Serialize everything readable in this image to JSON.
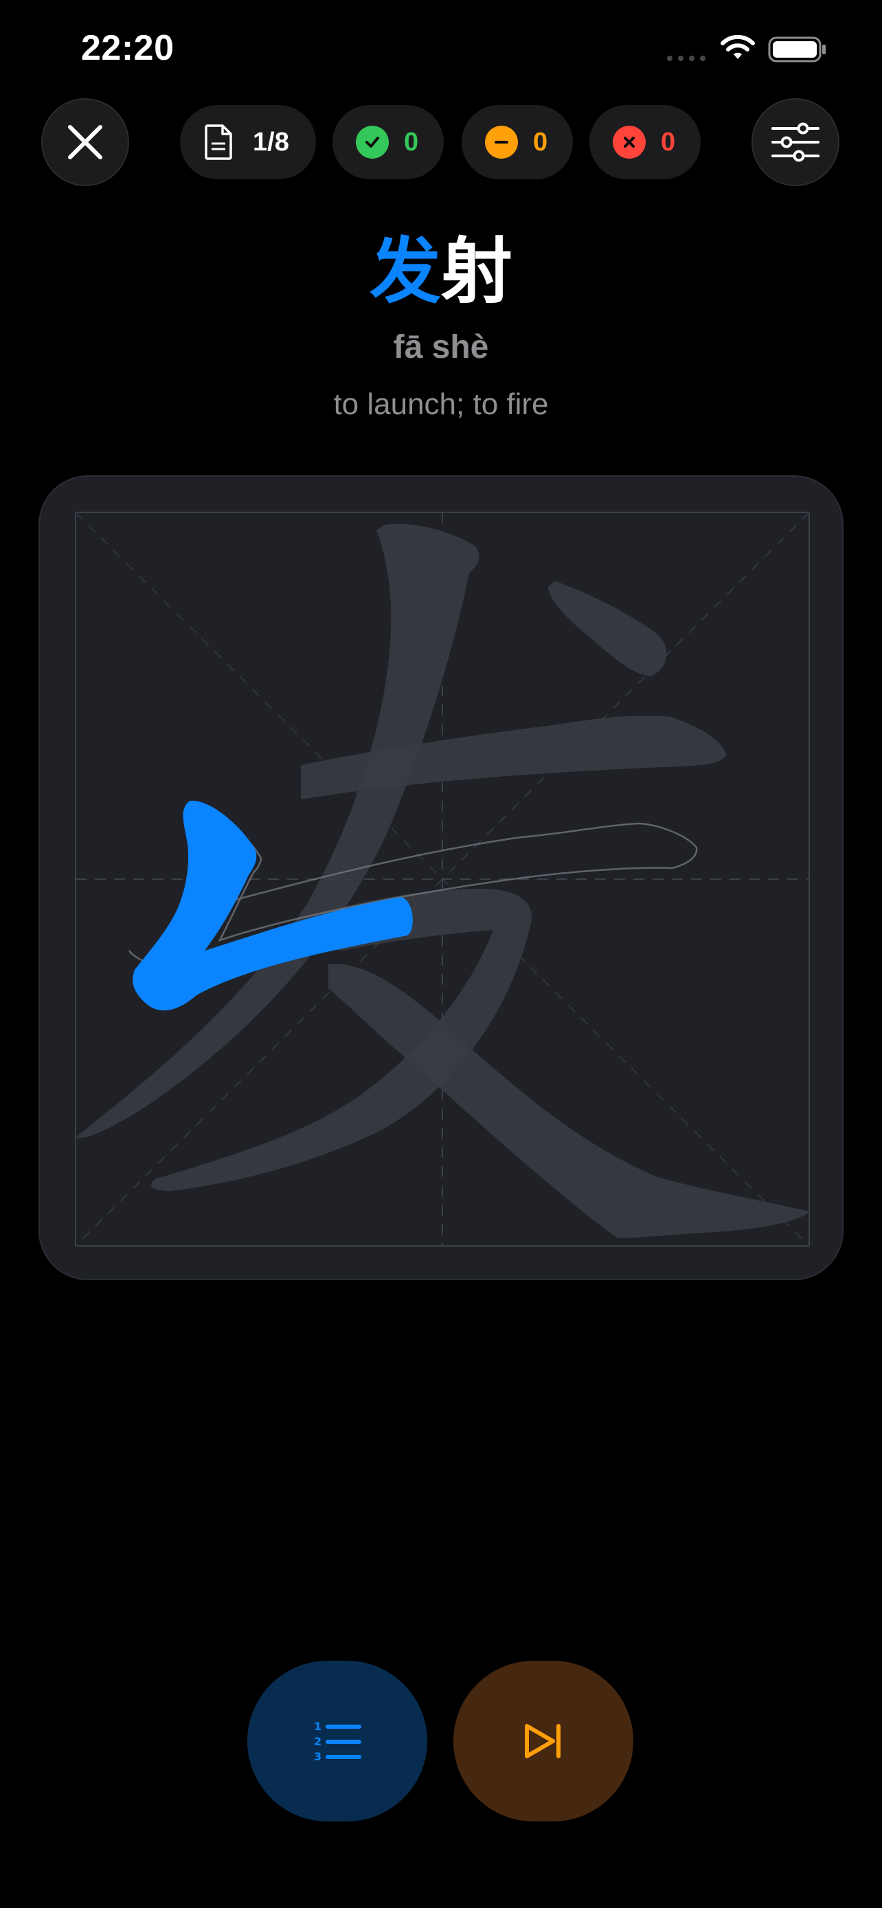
{
  "status_bar": {
    "time": "22:20",
    "signal_icon": "cellular-signal-icon",
    "wifi_icon": "wifi-icon",
    "battery_icon": "battery-icon"
  },
  "toolbar": {
    "close_icon": "close-icon",
    "settings_icon": "sliders-icon",
    "progress": {
      "icon": "document-icon",
      "label": "1/8"
    },
    "correct": {
      "icon": "checkmark-circle-icon",
      "count": "0",
      "color": "#34c759"
    },
    "partial": {
      "icon": "minus-circle-icon",
      "count": "0",
      "color": "#ff9f0a"
    },
    "wrong": {
      "icon": "x-circle-icon",
      "count": "0",
      "color": "#ff453a"
    }
  },
  "word": {
    "active_char": "发",
    "rest_chars": "射",
    "pinyin": "fā shè",
    "meaning": "to launch; to fire",
    "accent_color": "#0a84ff"
  },
  "canvas": {
    "character": "发",
    "guide": "tian-zi-ge grid",
    "strokes_total": 5,
    "strokes_completed": 1
  },
  "bottom_actions": {
    "stroke_order_icon": "numbered-list-icon",
    "skip_icon": "skip-forward-icon"
  }
}
